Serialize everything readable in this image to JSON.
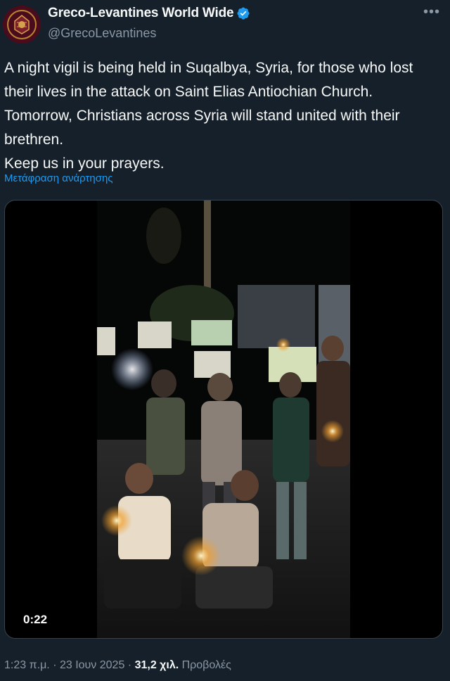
{
  "author": {
    "display_name": "Greco-Levantines World Wide",
    "handle": "@GrecoLevantines",
    "avatar_icon": "crest-avatar-icon",
    "verified_icon": "verified-badge-icon",
    "more_icon": "more-options-icon"
  },
  "tweet": {
    "paragraphs": [
      "A night vigil is being held in Suqalbya, Syria, for those who lost their lives in the attack on Saint Elias Antiochian Church.",
      "Tomorrow, Christians across Syria will stand united with their brethren.",
      "Keep us in your prayers."
    ],
    "translate_label": "Μετάφραση ανάρτησης"
  },
  "media": {
    "duration": "0:22"
  },
  "meta": {
    "time": "1:23 π.μ.",
    "separator": "·",
    "date": "23 Ιουν 2025",
    "views_count": "31,2 χιλ.",
    "views_label": "Προβολές"
  },
  "colors": {
    "background": "#15202b",
    "text": "#f7f9f9",
    "muted": "#8b98a5",
    "link": "#1d9bf0",
    "verified": "#1d9bf0"
  }
}
